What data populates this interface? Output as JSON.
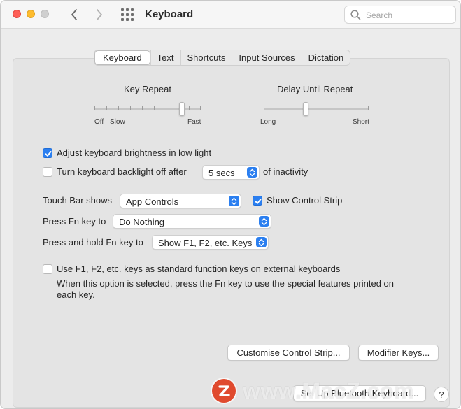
{
  "window": {
    "title": "Keyboard",
    "search_placeholder": "Search"
  },
  "tabs": [
    {
      "label": "Keyboard",
      "active": true
    },
    {
      "label": "Text",
      "active": false
    },
    {
      "label": "Shortcuts",
      "active": false
    },
    {
      "label": "Input Sources",
      "active": false
    },
    {
      "label": "Dictation",
      "active": false
    }
  ],
  "key_repeat": {
    "title": "Key Repeat",
    "labels": {
      "off": "Off",
      "slow": "Slow",
      "fast": "Fast"
    },
    "level": 0.83
  },
  "delay_until_repeat": {
    "title": "Delay Until Repeat",
    "labels": {
      "long": "Long",
      "short": "Short"
    },
    "level": 0.4
  },
  "brightness": {
    "label": "Adjust keyboard brightness in low light",
    "checked": true
  },
  "backlight": {
    "label": "Turn keyboard backlight off after",
    "checked": false,
    "value": "5 secs",
    "suffix": "of inactivity"
  },
  "touch_bar": {
    "label": "Touch Bar shows",
    "value": "App Controls",
    "control_strip_label": "Show Control Strip",
    "control_strip_checked": true
  },
  "fn_key": {
    "label": "Press Fn key to",
    "value": "Do Nothing"
  },
  "fn_hold": {
    "label": "Press and hold Fn key to",
    "value": "Show F1, F2, etc. Keys"
  },
  "function_keys": {
    "label": "Use F1, F2, etc. keys as standard function keys on external keyboards",
    "checked": false,
    "description_line1": "When this option is selected, press the Fn key to use the special features printed on",
    "description_line2": "each key."
  },
  "buttons": {
    "customise": "Customise Control Strip...",
    "modifier": "Modifier Keys...",
    "bluetooth": "Set Up Bluetooth Keyboard...",
    "help": "?"
  },
  "watermark": {
    "logo_letter": "Z",
    "text": "www.MacZ.com"
  },
  "colors": {
    "accent": "#2b7ff0",
    "watermark_logo": "#e04a2e"
  }
}
